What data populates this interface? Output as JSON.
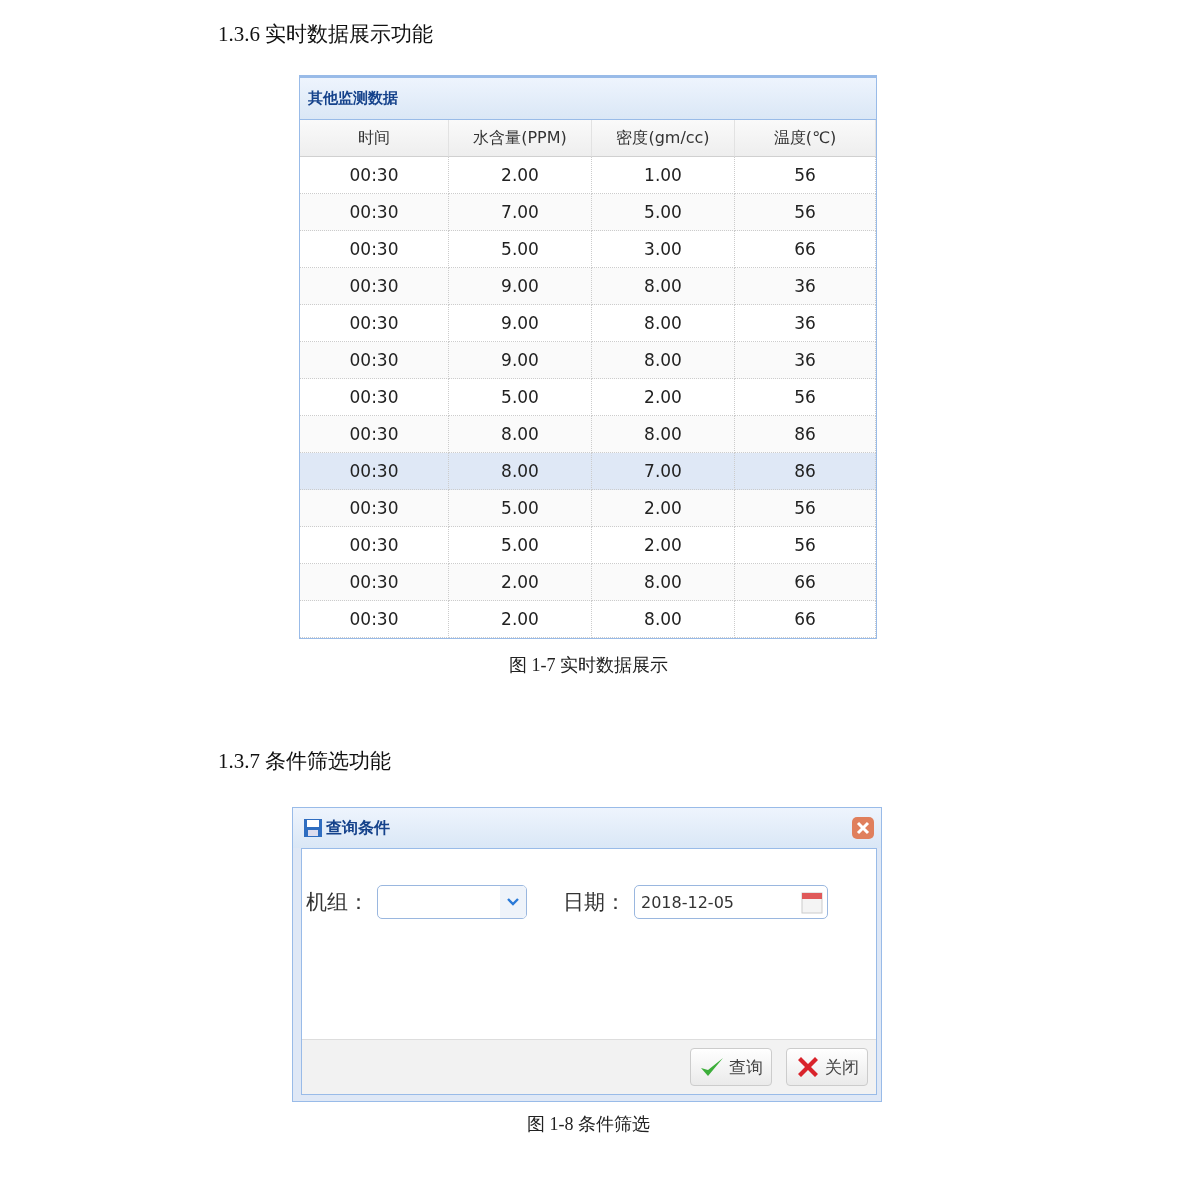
{
  "section_1": {
    "heading": "1.3.6  实时数据展示功能",
    "panel": {
      "title": "其他监测数据",
      "table": {
        "columns": [
          "时间",
          "水含量(PPM)",
          "密度(gm/cc)",
          "温度(℃)"
        ],
        "rows": [
          {
            "cells": [
              "00:30",
              "2.00",
              "1.00",
              "56"
            ],
            "selected": false
          },
          {
            "cells": [
              "00:30",
              "7.00",
              "5.00",
              "56"
            ],
            "selected": false
          },
          {
            "cells": [
              "00:30",
              "5.00",
              "3.00",
              "66"
            ],
            "selected": false
          },
          {
            "cells": [
              "00:30",
              "9.00",
              "8.00",
              "36"
            ],
            "selected": false
          },
          {
            "cells": [
              "00:30",
              "9.00",
              "8.00",
              "36"
            ],
            "selected": false
          },
          {
            "cells": [
              "00:30",
              "9.00",
              "8.00",
              "36"
            ],
            "selected": false
          },
          {
            "cells": [
              "00:30",
              "5.00",
              "2.00",
              "56"
            ],
            "selected": false
          },
          {
            "cells": [
              "00:30",
              "8.00",
              "8.00",
              "86"
            ],
            "selected": false
          },
          {
            "cells": [
              "00:30",
              "8.00",
              "7.00",
              "86"
            ],
            "selected": true
          },
          {
            "cells": [
              "00:30",
              "5.00",
              "2.00",
              "56"
            ],
            "selected": false
          },
          {
            "cells": [
              "00:30",
              "5.00",
              "2.00",
              "56"
            ],
            "selected": false
          },
          {
            "cells": [
              "00:30",
              "2.00",
              "8.00",
              "66"
            ],
            "selected": false
          },
          {
            "cells": [
              "00:30",
              "2.00",
              "8.00",
              "66"
            ],
            "selected": false
          }
        ]
      }
    },
    "caption": "图 1-7  实时数据展示"
  },
  "section_2": {
    "heading": "1.3.7  条件筛选功能",
    "dialog": {
      "title": "查询条件",
      "fields": [
        {
          "kind": "combo",
          "label": "机组："
        },
        {
          "kind": "date",
          "label": "日期：",
          "value": "2018-12-05"
        }
      ],
      "buttons": [
        {
          "kind": "ok",
          "label": "查询"
        },
        {
          "kind": "cancel",
          "label": "关闭"
        }
      ]
    },
    "caption": "图 1-8  条件筛选"
  }
}
